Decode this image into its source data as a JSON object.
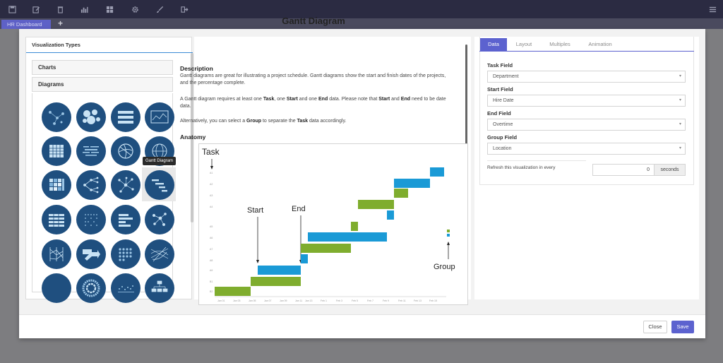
{
  "toolbar": {
    "icons": [
      "save-icon",
      "edit-icon",
      "trash-icon",
      "bar-chart-icon",
      "grid-icon",
      "gear-icon",
      "brush-icon",
      "exit-icon",
      "menu-icon"
    ]
  },
  "tabs": {
    "dashboard_label": "HR Dashboard",
    "add_label": "+"
  },
  "left_panel": {
    "title": "Visualization Types",
    "charts_label": "Charts",
    "diagrams_label": "Diagrams",
    "tooltip": "Gantt Diagram"
  },
  "description": {
    "title": "Gantt Diagram",
    "heading": "Description",
    "para1": "Gantt diagrams are great for illustrating a project schedule. Gantt diagrams show the start and finish dates of the projects, and the percentage complete.",
    "para2_a": "A Gantt diagram requires at least one ",
    "para2_b": "Task",
    "para2_c": ", one ",
    "para2_d": "Start",
    "para2_e": " and one ",
    "para2_f": "End",
    "para2_g": " data. Please note that ",
    "para2_h": "Start",
    "para2_i": " and ",
    "para2_j": "End",
    "para2_k": " need to be date data.",
    "para3_a": "Alternatively, you can select a ",
    "para3_b": "Group",
    "para3_c": " to separate the ",
    "para3_d": "Task",
    "para3_e": " data accordingly.",
    "anatomy_heading": "Anatomy",
    "anatomy_labels": {
      "task": "Task",
      "start": "Start",
      "end": "End",
      "group": "Group"
    },
    "colors": {
      "blue": "#1a9ad6",
      "green": "#7fad2e"
    }
  },
  "settings": {
    "tabs": [
      "Data",
      "Layout",
      "Multiples",
      "Animation"
    ],
    "active_tab": "Data",
    "task_field_label": "Task Field",
    "task_field_value": "Department",
    "start_field_label": "Start Field",
    "start_field_value": "Hire Date",
    "end_field_label": "End Field",
    "end_field_value": "Overtime",
    "group_field_label": "Group Field",
    "group_field_value": "Location",
    "refresh_label": "Refresh this visualization in every",
    "refresh_value": "0",
    "refresh_unit": "seconds"
  },
  "footer": {
    "close_label": "Close",
    "save_label": "Save"
  },
  "accent_color": "#5c62cf"
}
